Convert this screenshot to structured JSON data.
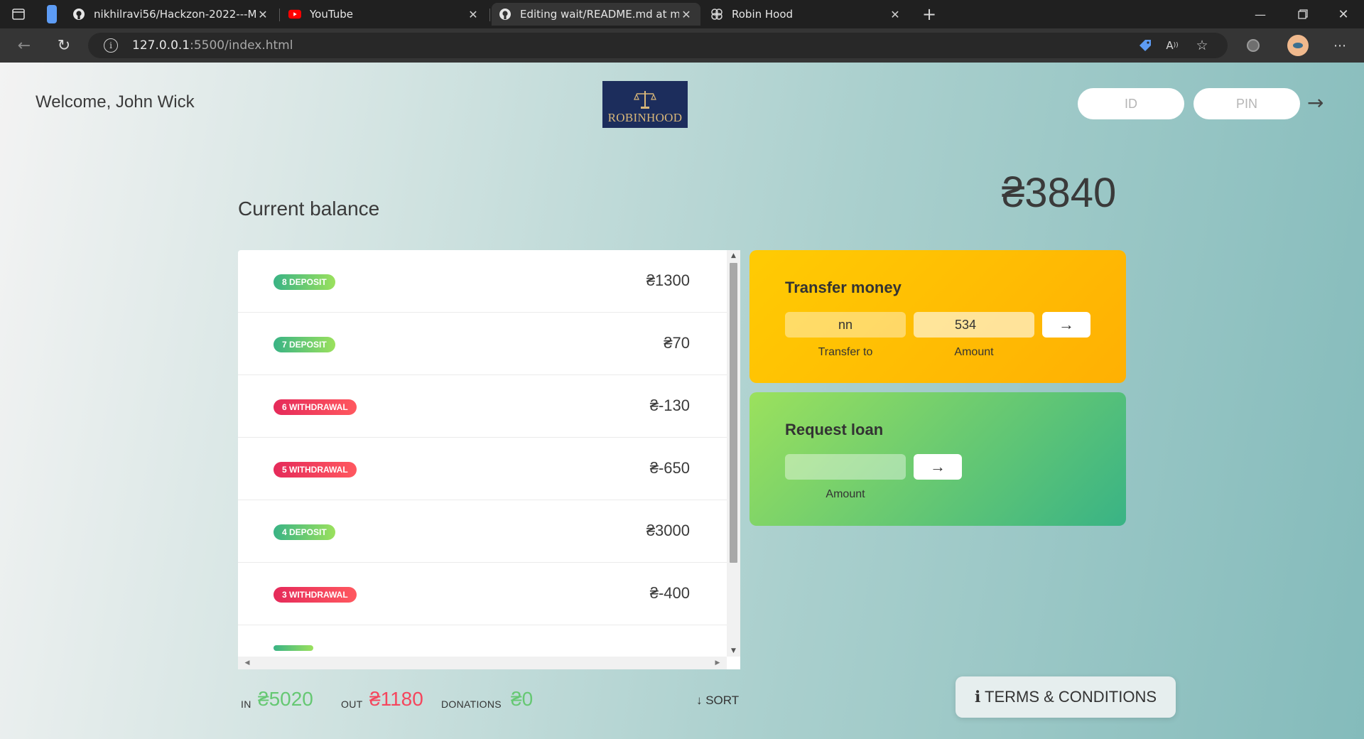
{
  "browser": {
    "tabs": [
      {
        "title": "nikhilravi56/Hackzon-2022---Ma",
        "icon": "github-icon",
        "active": false
      },
      {
        "title": "YouTube",
        "icon": "youtube-icon",
        "active": false
      },
      {
        "title": "Editing wait/README.md at mair",
        "icon": "github-icon",
        "active": true
      },
      {
        "title": "Robin Hood",
        "icon": "app-icon",
        "active": false
      }
    ],
    "url_host": "127.0.0.1",
    "url_rest": ":5500/index.html"
  },
  "header": {
    "welcome": "Welcome, John Wick",
    "logo_text": "ROBINHOOD",
    "id_placeholder": "ID",
    "pin_placeholder": "PIN",
    "login_arrow": "→"
  },
  "balance": {
    "label": "Current balance",
    "value": "₴3840"
  },
  "movements": [
    {
      "type_label": "8 DEPOSIT",
      "kind": "deposit",
      "value": "₴1300"
    },
    {
      "type_label": "7 DEPOSIT",
      "kind": "deposit",
      "value": "₴70"
    },
    {
      "type_label": "6 WITHDRAWAL",
      "kind": "withdrawal",
      "value": "₴-130"
    },
    {
      "type_label": "5 WITHDRAWAL",
      "kind": "withdrawal",
      "value": "₴-650"
    },
    {
      "type_label": "4 DEPOSIT",
      "kind": "deposit",
      "value": "₴3000"
    },
    {
      "type_label": "3 WITHDRAWAL",
      "kind": "withdrawal",
      "value": "₴-400"
    }
  ],
  "transfer": {
    "title": "Transfer money",
    "to_value": "nn",
    "amount_value": "534",
    "to_label": "Transfer to",
    "amount_label": "Amount",
    "button": "→"
  },
  "loan": {
    "title": "Request loan",
    "amount_value": "",
    "amount_label": "Amount",
    "button": "→"
  },
  "summary": {
    "in_label": "IN",
    "in_value": "₴5020",
    "out_label": "OUT",
    "out_value": "₴1180",
    "donations_label": "DONATIONS",
    "donations_value": "₴0",
    "sort_label": "↓ SORT"
  },
  "terms": {
    "label": "ℹ TERMS & CONDITIONS"
  },
  "colors": {
    "deposit": "#39b385",
    "withdrawal": "#e52a5a",
    "transfer_bg": "#ffb003",
    "loan_bg": "#39b385",
    "in_value": "#66c873",
    "out_value": "#f5465d"
  }
}
